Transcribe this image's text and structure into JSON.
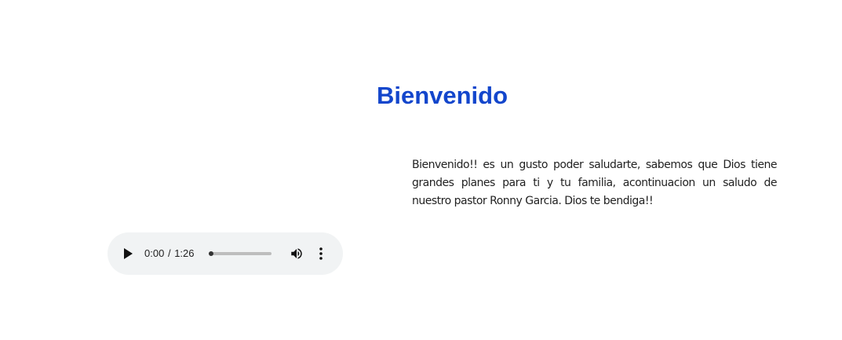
{
  "page": {
    "title": "Bienvenido",
    "message": "Bienvenido!! es un gusto poder saludarte, sabemos que Dios tiene grandes planes para ti y tu familia, acontinuacion un saludo de nuestro pastor Ronny Garcia. Dios te bendiga!!"
  },
  "audio_player": {
    "current_time": "0:00",
    "separator": "/",
    "duration": "1:26",
    "progress_fraction": 0.0,
    "icons": {
      "play": "play-icon",
      "volume": "volume-icon",
      "more": "more-vertical-icon"
    }
  },
  "colors": {
    "title": "#1346cc",
    "player_background": "#f1f3f4",
    "text": "#222222"
  }
}
